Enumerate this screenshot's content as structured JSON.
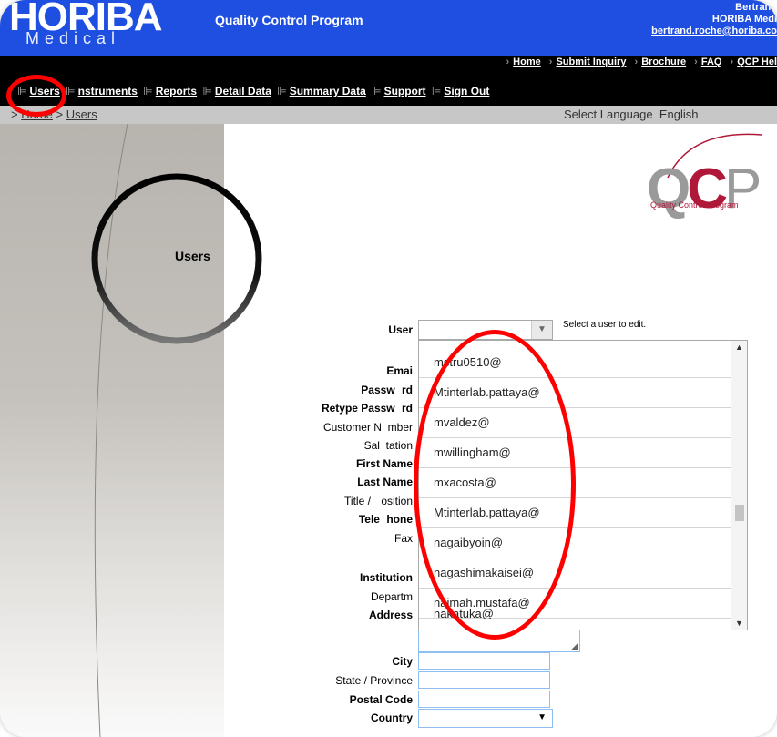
{
  "header": {
    "logo": "HORIBA",
    "logo_sub": "Medical",
    "app_title": "Quality Control Program",
    "user_name": "Bertrand",
    "user_org": "HORIBA Medi",
    "user_email": "bertrand.roche@horiba.co"
  },
  "top_links": [
    "Home",
    "Submit Inquiry",
    "Brochure",
    "FAQ",
    "QCP Hel"
  ],
  "nav": [
    "Users",
    "Instruments",
    "Reports",
    "Detail Data",
    "Summary Data",
    "Support",
    "Sign Out"
  ],
  "nav_display": {
    "instruments": "nstruments"
  },
  "breadcrumb": {
    "sep": ">",
    "home": "Home",
    "current": "Users",
    "lang_label": "Select Language",
    "lang_value": "English"
  },
  "sidebar": {
    "title": "Users"
  },
  "logo_qcp": {
    "q": "Q",
    "c": "C",
    "p": "P",
    "caption": "Quality Control Program"
  },
  "form": {
    "user_label": "User",
    "user_hint": "Select a user to edit.",
    "labels": {
      "email": "Emai",
      "password": "Passw",
      "password2": "rd",
      "retype": "Retype Passw",
      "retype2": "rd",
      "customer": "Customer N",
      "customer2": "mber",
      "salutation": "Sal",
      "salutation2": "tation",
      "first": "First",
      "first2": "Name",
      "last": "Last",
      "last2": "Name",
      "title": "Title /",
      "title2": "osition",
      "telephone": "Tele",
      "telephone2": "hone",
      "fax": "Fax",
      "institution": "Institution",
      "department": "Departm",
      "address": "Address",
      "city": "City",
      "state": "State / Province",
      "postal": "Postal Code",
      "country": "Country"
    }
  },
  "dropdown_items": [
    "mstru0510@",
    "Mtinterlab.pattaya@",
    "mvaldez@",
    "mwillingham@",
    "mxacosta@",
    "Mtinterlab.pattaya@",
    "nagaibyoin@",
    "nagashimakaisei@",
    "naimah.mustafa@",
    "nakatuka@"
  ],
  "colors": {
    "header_blue": "#1f4fe0",
    "annotation": "#ff0000",
    "qcp_red": "#b0183a"
  }
}
